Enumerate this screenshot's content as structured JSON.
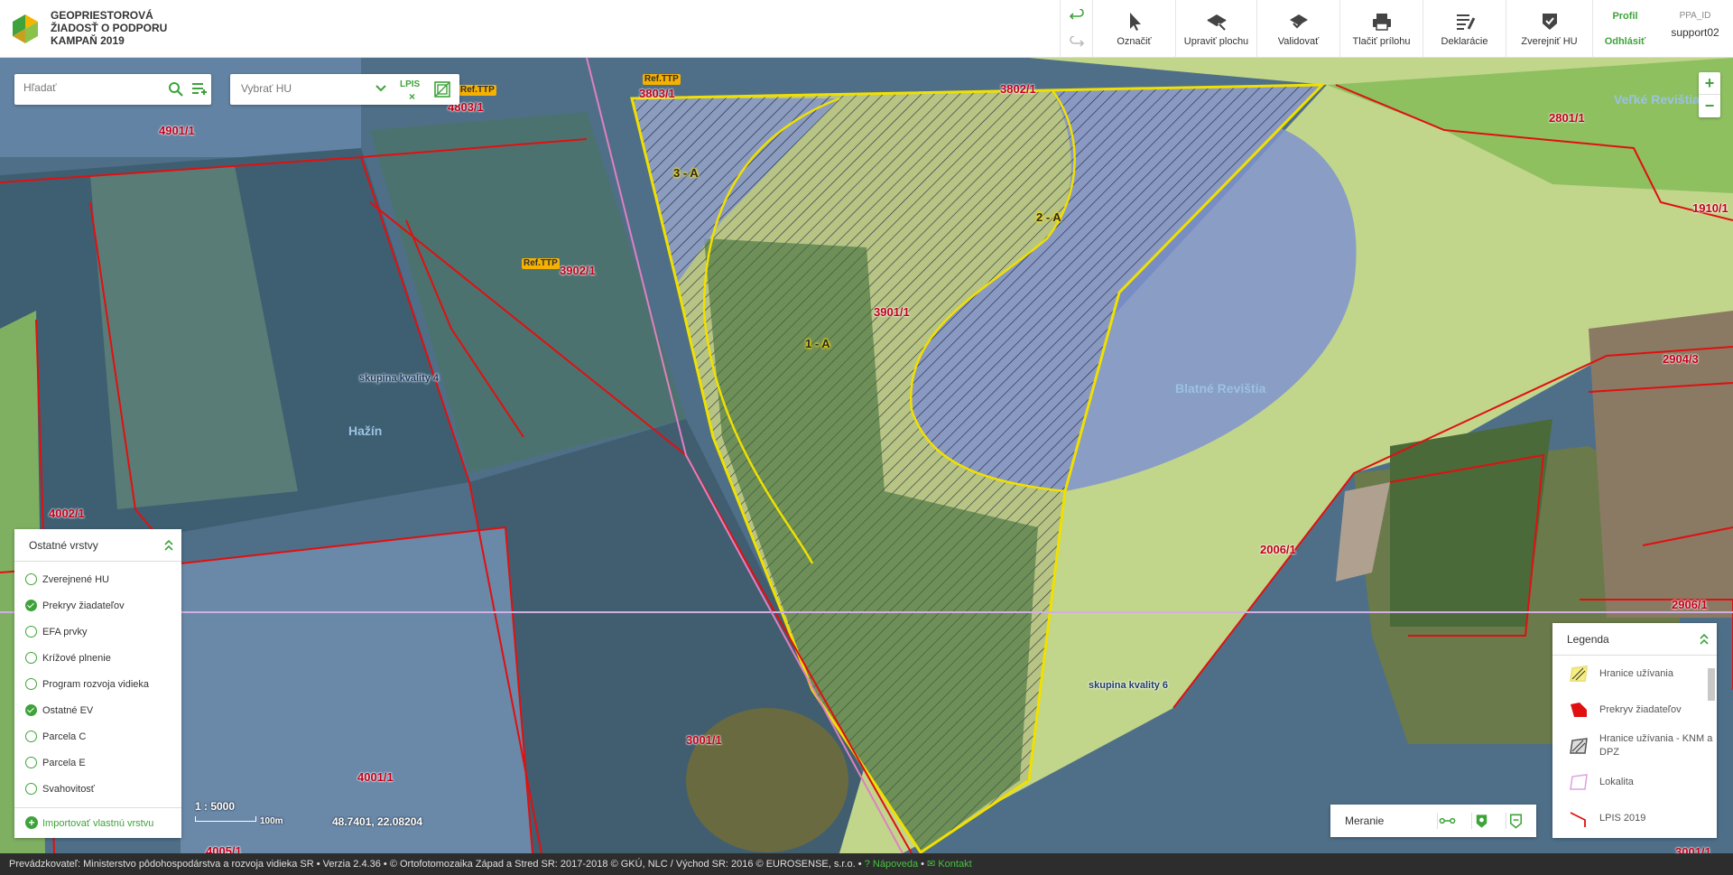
{
  "app": {
    "title_lines": [
      "GEOPRIESTOROVÁ",
      "ŽIADOSŤ O PODPORU",
      "KAMPAŇ 2019"
    ],
    "logo_colors": [
      "#f5b400",
      "#3ea33a",
      "#8bc34a",
      "#c8a020"
    ]
  },
  "toolbar": {
    "undo_icon": "undo-icon",
    "redo_icon": "redo-icon",
    "tools": [
      {
        "label": "Označiť",
        "icon": "pointer-icon"
      },
      {
        "label": "Upraviť plochu",
        "icon": "edit-area-icon"
      },
      {
        "label": "Validovať",
        "icon": "validate-icon"
      },
      {
        "label": "Tlačiť prílohu",
        "icon": "print-icon"
      },
      {
        "label": "Deklarácie",
        "icon": "declarations-icon"
      },
      {
        "label": "Zverejniť HU",
        "icon": "publish-icon"
      }
    ],
    "profile_label": "Profil",
    "logout_label": "Odhlásiť",
    "ppa_id_label": "PPA_ID",
    "username": "support02"
  },
  "search": {
    "placeholder": "Hľadať"
  },
  "hu_select": {
    "value": "Vybrať HU",
    "lpis_label": "LPIS"
  },
  "map": {
    "parcel_labels": [
      {
        "text": "4901/1"
      },
      {
        "text": "4803/1"
      },
      {
        "text": "3803/1"
      },
      {
        "text": "3802/1"
      },
      {
        "text": "2801/1"
      },
      {
        "text": "1910/1"
      },
      {
        "text": "3902/1"
      },
      {
        "text": "3901/1"
      },
      {
        "text": "2904/3"
      },
      {
        "text": "4002/1"
      },
      {
        "text": "2006/1"
      },
      {
        "text": "2906/1"
      },
      {
        "text": "3001/1"
      },
      {
        "text": "4001/1"
      },
      {
        "text": "4005/1"
      },
      {
        "text": "3001/1"
      }
    ],
    "hu_labels": [
      {
        "text": "3 - A"
      },
      {
        "text": "2 - A"
      },
      {
        "text": "1 - A"
      }
    ],
    "place_labels": [
      {
        "text": "Veľké Revištia"
      },
      {
        "text": "Blatné Revištia"
      },
      {
        "text": "Hažín"
      }
    ],
    "quality_labels": [
      {
        "text": "skupina kvality 4"
      },
      {
        "text": "skupina kvality 6"
      }
    ],
    "ref_tags": [
      {
        "text": "Ref.TTP"
      },
      {
        "text": "Ref.TTP"
      },
      {
        "text": "Ref.TTP"
      }
    ],
    "colors": {
      "parcel_border": "#e01010",
      "hu_border": "#f0e000",
      "user_overlay": "#7aa0d8",
      "lpis_line": "#d080d0"
    }
  },
  "zoom": {
    "in": "+",
    "out": "−"
  },
  "layers": {
    "title": "Ostatné vrstvy",
    "items": [
      {
        "label": "Zverejnené HU",
        "checked": false
      },
      {
        "label": "Prekryv žiadateľov",
        "checked": true
      },
      {
        "label": "EFA prvky",
        "checked": false
      },
      {
        "label": "Krížové plnenie",
        "checked": false
      },
      {
        "label": "Program rozvoja vidieka",
        "checked": false
      },
      {
        "label": "Ostatné EV",
        "checked": true
      },
      {
        "label": "Parcela C",
        "checked": false
      },
      {
        "label": "Parcela E",
        "checked": false
      },
      {
        "label": "Svahovitosť",
        "checked": false
      }
    ],
    "import_label": "Importovať vlastnú vrstvu"
  },
  "scale": {
    "ratio": "1 : 5000",
    "bar_label": "100m"
  },
  "coords": "48.7401, 22.08204",
  "measure": {
    "label": "Meranie"
  },
  "legend": {
    "title": "Legenda",
    "items": [
      {
        "label": "Hranice užívania",
        "swatch": "hu-hatch"
      },
      {
        "label": "Prekryv žiadateľov",
        "swatch": "overlap-red"
      },
      {
        "label": "Hranice užívania - KNM a DPZ",
        "swatch": "hatch-gray"
      },
      {
        "label": "Lokalita",
        "swatch": "locality-pink"
      },
      {
        "label": "LPIS 2019",
        "swatch": "lpis-red"
      }
    ]
  },
  "footer": {
    "operator": "Prevádzkovateľ: Ministerstvo pôdohospodárstva a rozvoja vidieka SR",
    "version": "Verzia 2.4.36",
    "ortho": "© Ortofotomozaika Západ a Stred SR: 2017-2018 © GKÚ, NLC / Východ SR: 2016 © EUROSENSE, s.r.o.",
    "help": "Nápoveda",
    "contact": "Kontakt"
  }
}
